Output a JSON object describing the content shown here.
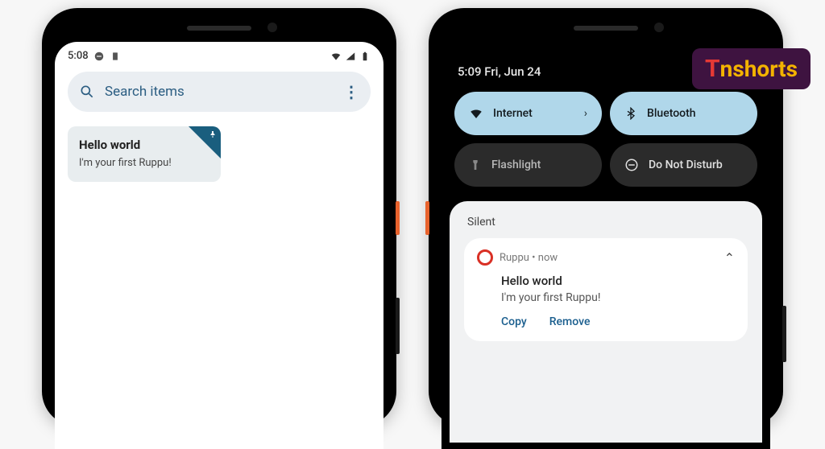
{
  "watermark": {
    "t": "T",
    "rest": "nshorts"
  },
  "phone1": {
    "status_time": "5:08",
    "search_placeholder": "Search items",
    "note_title": "Hello world",
    "note_body": "I'm your first Ruppu!"
  },
  "phone2": {
    "qs_time": "5:09 Fri, Jun 24",
    "tiles": {
      "internet": "Internet",
      "bluetooth": "Bluetooth",
      "flashlight": "Flashlight",
      "dnd": "Do Not Disturb"
    },
    "section_label": "Silent",
    "notif": {
      "app": "Ruppu",
      "time_suffix": " • now",
      "title": "Hello world",
      "text": "I'm your first Ruppu!",
      "action_copy": "Copy",
      "action_remove": "Remove"
    }
  }
}
